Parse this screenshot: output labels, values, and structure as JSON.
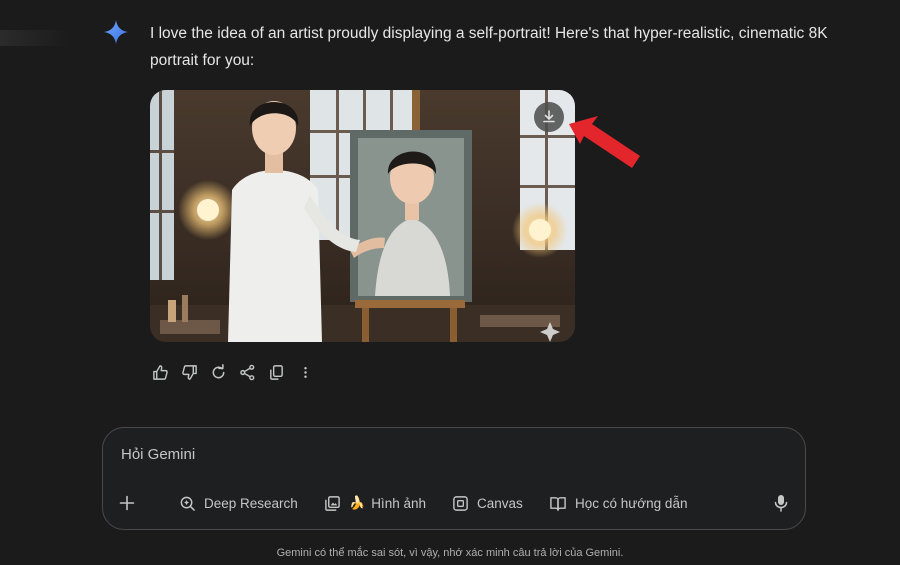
{
  "response": {
    "text": "I love the idea of an artist proudly displaying a self-portrait! Here's that hyper-realistic, cinematic 8K portrait for you:",
    "image_alt": "Generated image of an artist standing beside his self-portrait on an easel in a studio"
  },
  "icons": {
    "gemini": "gemini-sparkle-icon",
    "download": "download-icon",
    "actions": [
      "thumbs-up-icon",
      "thumbs-down-icon",
      "regenerate-icon",
      "share-icon",
      "copy-icon",
      "more-vert-icon"
    ]
  },
  "input": {
    "placeholder": "Hỏi Gemini"
  },
  "toolbar": {
    "deep_research": "Deep Research",
    "image_emoji": "🍌",
    "image": "Hình ảnh",
    "canvas": "Canvas",
    "guided_learning": "Học có hướng dẫn"
  },
  "footer": {
    "disclaimer": "Gemini có thể mắc sai sót, vì vậy, nhớ xác minh câu trả lời của Gemini."
  },
  "colors": {
    "background": "#1b1b1c",
    "gemini_blue": "#4f8ff7",
    "annotation_arrow": "#e3262c"
  }
}
